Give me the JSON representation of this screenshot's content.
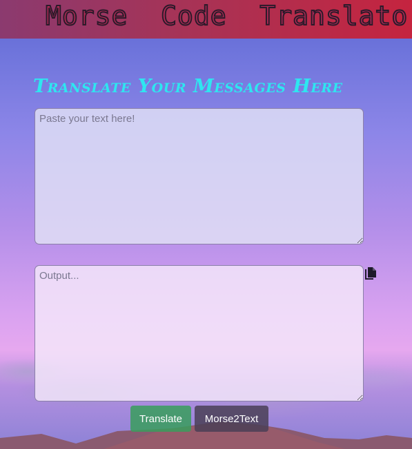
{
  "header": {
    "title": "Morse  Code  Translator"
  },
  "main": {
    "tagline": "Translate Your Messages Here",
    "input": {
      "value": "",
      "placeholder": "Paste your text here!"
    },
    "output": {
      "value": "",
      "placeholder": "Output..."
    },
    "copy_icon": "copy-icon",
    "buttons": {
      "translate_label": "Translate",
      "morse2text_label": "Morse2Text"
    }
  },
  "colors": {
    "header_start": "#8b3a6f",
    "header_end": "#c5243f",
    "tagline": "#2ee6f0",
    "translate_button": "#389e5c",
    "morse2text_button": "#4a4056"
  }
}
